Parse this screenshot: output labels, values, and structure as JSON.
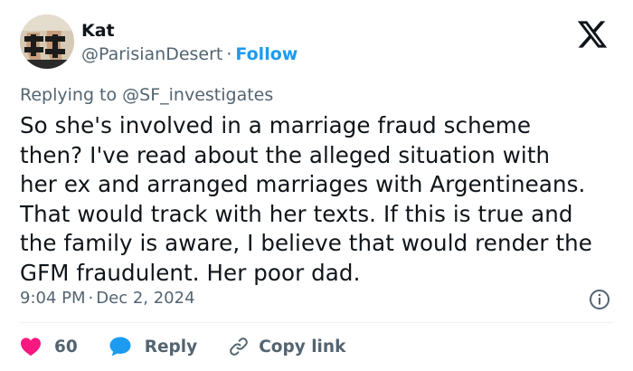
{
  "author": {
    "name": "Kat",
    "handle": "@ParisianDesert",
    "separator": "·",
    "follow_label": "Follow"
  },
  "reply_context": {
    "prefix": "Replying to ",
    "mention": "@SF_investigates"
  },
  "tweet": {
    "lines": [
      "So she's involved in a marriage fraud scheme",
      "then? I've read about the alleged situation with",
      "her ex and arranged marriages with Argentineans.",
      "That would track with her texts. If this is true and",
      "the family is aware, I believe that would render the",
      "GFM fraudulent. Her poor dad."
    ],
    "time": "9:04 PM",
    "separator": "·",
    "date": "Dec 2, 2024"
  },
  "actions": {
    "like_count": "60",
    "reply_label": "Reply",
    "copy_label": "Copy link"
  },
  "icons": {
    "brand": "x-logo-icon",
    "info": "info-icon",
    "like": "heart-icon",
    "reply": "speech-bubble-icon",
    "copy": "link-icon"
  },
  "colors": {
    "text": "#0f1419",
    "secondary": "#536471",
    "accent": "#1d9bf0",
    "like": "#f91880",
    "divider": "#eff3f4"
  }
}
